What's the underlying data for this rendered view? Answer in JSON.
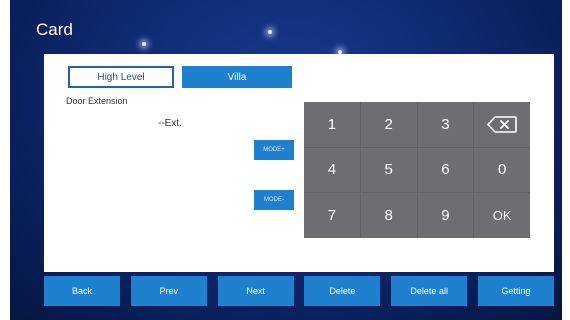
{
  "header": {
    "title": "Card"
  },
  "tabs": {
    "high_level": "High Level",
    "villa": "Villa"
  },
  "fields": {
    "door_extension": "Door Extension",
    "ext_value": "--Ext."
  },
  "mode": {
    "plus": "MODE+",
    "minus": "MODE-"
  },
  "keypad": {
    "keys": [
      "1",
      "2",
      "3",
      "",
      "4",
      "5",
      "6",
      "0",
      "7",
      "8",
      "9",
      "OK"
    ]
  },
  "bottom": {
    "back": "Back",
    "prev": "Prev",
    "next": "Next",
    "delete": "Delete",
    "delete_all": "Delete all",
    "getting": "Getting"
  },
  "icons": {
    "backspace": "backspace-icon"
  },
  "colors": {
    "accent": "#1f80d0",
    "background": "#0e2a72",
    "keypad": "#6c6e74"
  }
}
